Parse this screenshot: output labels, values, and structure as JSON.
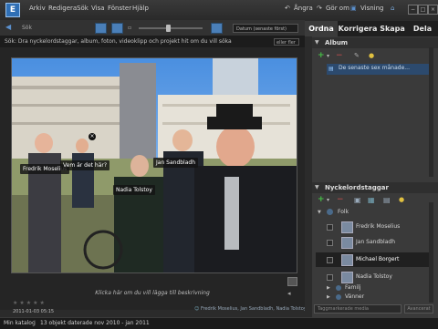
{
  "menubar": {
    "logo": "E",
    "items": [
      "Arkiv",
      "Redigera",
      "Sök",
      "Visa",
      "Fönster",
      "Hjälp"
    ],
    "undo": "Ångra",
    "redo": "Gör om",
    "view_mode": "Visning",
    "window_buttons": [
      "−",
      "□",
      "×"
    ]
  },
  "toolbar": {
    "back": "Sök",
    "sort_select": "Datum (senaste först)"
  },
  "tabs": [
    "Ordna",
    "Korrigera",
    "Skapa",
    "Dela"
  ],
  "search": {
    "text": "Sök: Dra nyckelordstaggar, album, foton, videoklipp och projekt hit om du vill söka",
    "or_select": "eller fler"
  },
  "photo": {
    "tags": [
      "Fredrik Moselius",
      "Vem är det här?",
      "Jan Sandbladh",
      "Nadia Tolstoy"
    ],
    "caption": "Klicka här om du vill lägga till beskrivning",
    "date": "2011-01-03 05:15",
    "stars": "★★★★★",
    "people": "Fredrik Moselius, Jan Sandbladh, Nadia Tolstoy"
  },
  "album": {
    "title": "Album",
    "item": "De senaste sex månade..."
  },
  "keywords": {
    "title": "Nyckelordstaggar",
    "rows": [
      "Folk",
      "Fredrik Moselius",
      "Jan Sandbladh",
      "Michael Borgert",
      "Nadia Tolstoy",
      "Familj",
      "Vänner"
    ],
    "search_placeholder": "Taggmarkerade media",
    "search_button": "Avancerat"
  },
  "status": {
    "catalog": "Min katalog",
    "count": "13 objekt daterade nov 2010 - jan 2011"
  }
}
